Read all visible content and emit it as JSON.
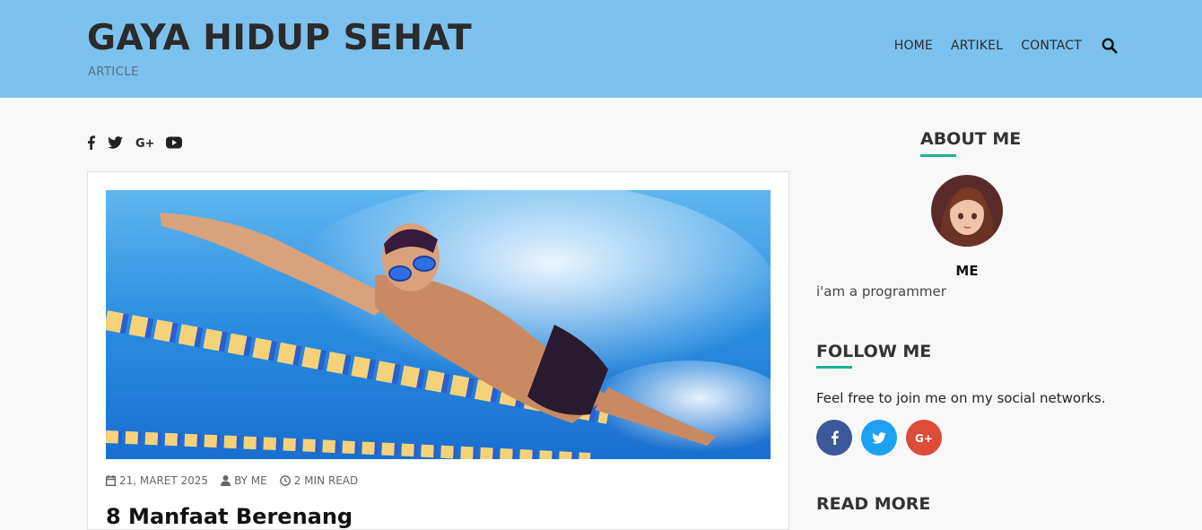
{
  "header": {
    "title": "GAYA HIDUP SEHAT",
    "tagline": "ARTICLE",
    "nav": [
      "HOME",
      "ARTIKEL",
      "CONTACT"
    ],
    "search_icon": "search-icon"
  },
  "top_social": [
    "facebook-icon",
    "twitter-icon",
    "google-plus-icon",
    "youtube-icon"
  ],
  "post": {
    "image": "swimmer-photo",
    "date": "21, MARET 2025",
    "author": "BY ME",
    "read_time": "2 MIN READ",
    "title": "8 Manfaat Berenang"
  },
  "sidebar": {
    "about_heading": "ABOUT ME",
    "about_name": "ME",
    "about_desc": "i'am a programmer",
    "follow_heading": "FOLLOW ME",
    "follow_text": "Feel free to join me on my social networks.",
    "follow_icons": [
      "facebook-icon",
      "twitter-icon",
      "google-plus-icon"
    ],
    "readmore_heading": "READ MORE"
  },
  "colors": {
    "header_bg": "#7dc1ee",
    "accent": "#1ab394",
    "facebook": "#3b5998",
    "twitter": "#1da1f2",
    "google_plus": "#dd4b39"
  }
}
